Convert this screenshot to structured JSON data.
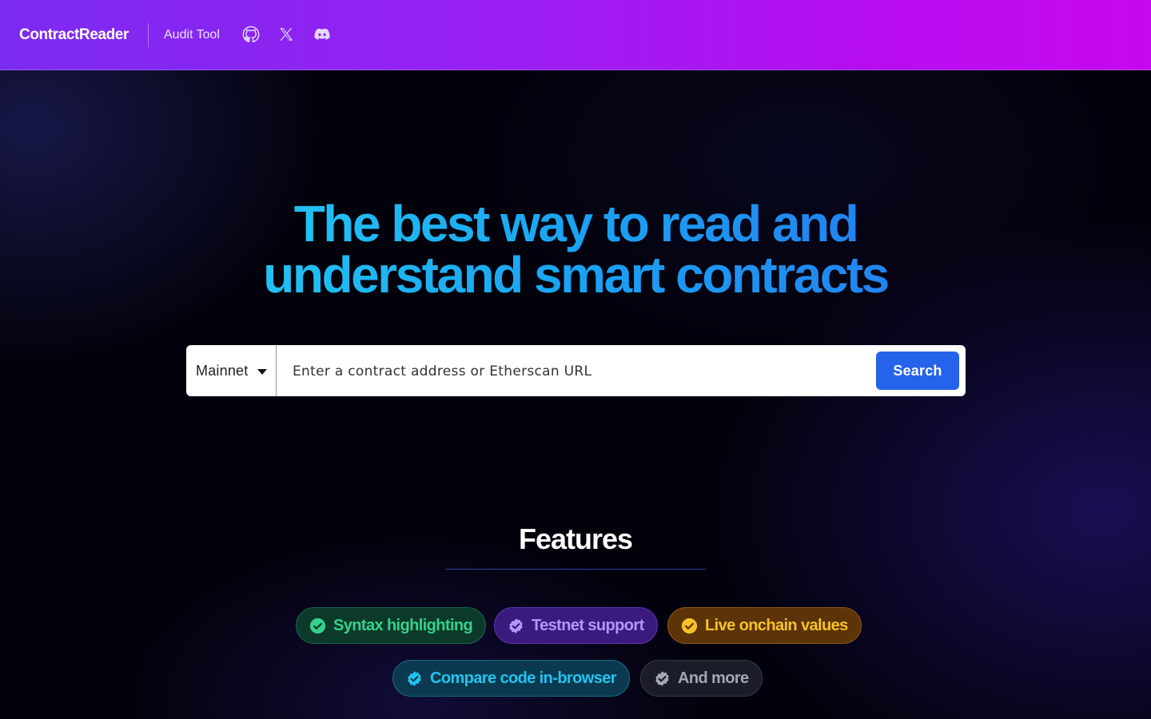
{
  "header": {
    "brand": "ContractReader",
    "nav_link": "Audit Tool",
    "icons": [
      "github-icon",
      "x-twitter-icon",
      "discord-icon"
    ]
  },
  "hero": {
    "line1": "The best way to read and",
    "line2": "understand smart contracts"
  },
  "search": {
    "network_selected": "Mainnet",
    "placeholder": "Enter a contract address or Etherscan URL",
    "value": "",
    "button_label": "Search"
  },
  "features": {
    "title": "Features",
    "items": [
      {
        "label": "Syntax highlighting",
        "color": "#37d08c"
      },
      {
        "label": "Testnet support",
        "color": "#b594ff"
      },
      {
        "label": "Live onchain values",
        "color": "#f7c12a"
      },
      {
        "label": "Compare code in-browser",
        "color": "#22c4ef"
      },
      {
        "label": "And more",
        "color": "#a2a6b6"
      }
    ]
  },
  "colors": {
    "header_gradient_start": "#7b2bf0",
    "header_gradient_end": "#c707ee",
    "accent_button": "#2563eb",
    "hero_gradient_start": "#22c1f2",
    "hero_gradient_end": "#2284f0"
  }
}
